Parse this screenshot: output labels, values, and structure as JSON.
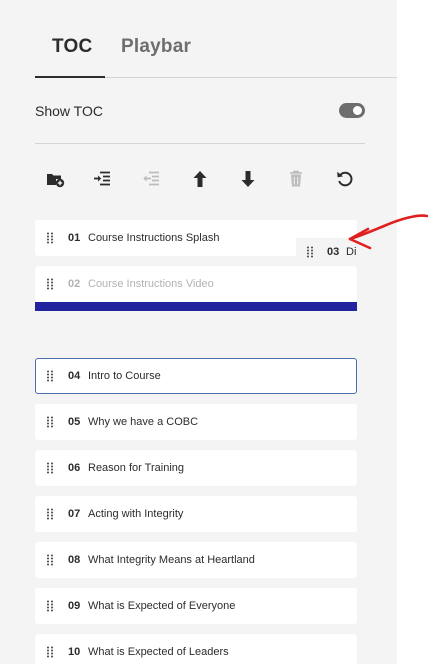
{
  "tabs": [
    {
      "label": "TOC",
      "active": true
    },
    {
      "label": "Playbar",
      "active": false
    }
  ],
  "show_toc": {
    "label": "Show TOC",
    "enabled": true
  },
  "toolbar": {
    "buttons": [
      {
        "icon": "add-folder-icon",
        "enabled": true
      },
      {
        "icon": "indent-icon",
        "enabled": true
      },
      {
        "icon": "outdent-icon",
        "enabled": false
      },
      {
        "icon": "move-up-icon",
        "enabled": true
      },
      {
        "icon": "move-down-icon",
        "enabled": true
      },
      {
        "icon": "delete-icon",
        "enabled": false
      },
      {
        "icon": "reset-icon",
        "enabled": true
      }
    ]
  },
  "toc_items": [
    {
      "number": "01",
      "title": "Course Instructions Splash"
    },
    {
      "number": "02",
      "title": "Course Instructions Video",
      "state": "dimmed"
    },
    {
      "number": "04",
      "title": "Intro to Course",
      "state": "selected"
    },
    {
      "number": "05",
      "title": "Why we have a COBC"
    },
    {
      "number": "06",
      "title": "Reason for Training"
    },
    {
      "number": "07",
      "title": "Acting with Integrity"
    },
    {
      "number": "08",
      "title": "What Integrity Means at Heartland"
    },
    {
      "number": "09",
      "title": "What is Expected of Everyone"
    },
    {
      "number": "10",
      "title": "What is Expected of Leaders"
    }
  ],
  "drag_ghost": {
    "number": "03",
    "title": "Di"
  },
  "colors": {
    "panel_bg": "#f4f4f4",
    "drop_indicator": "#2323a0",
    "selected_border": "#4b6eaf",
    "annotation": "#e02020"
  }
}
